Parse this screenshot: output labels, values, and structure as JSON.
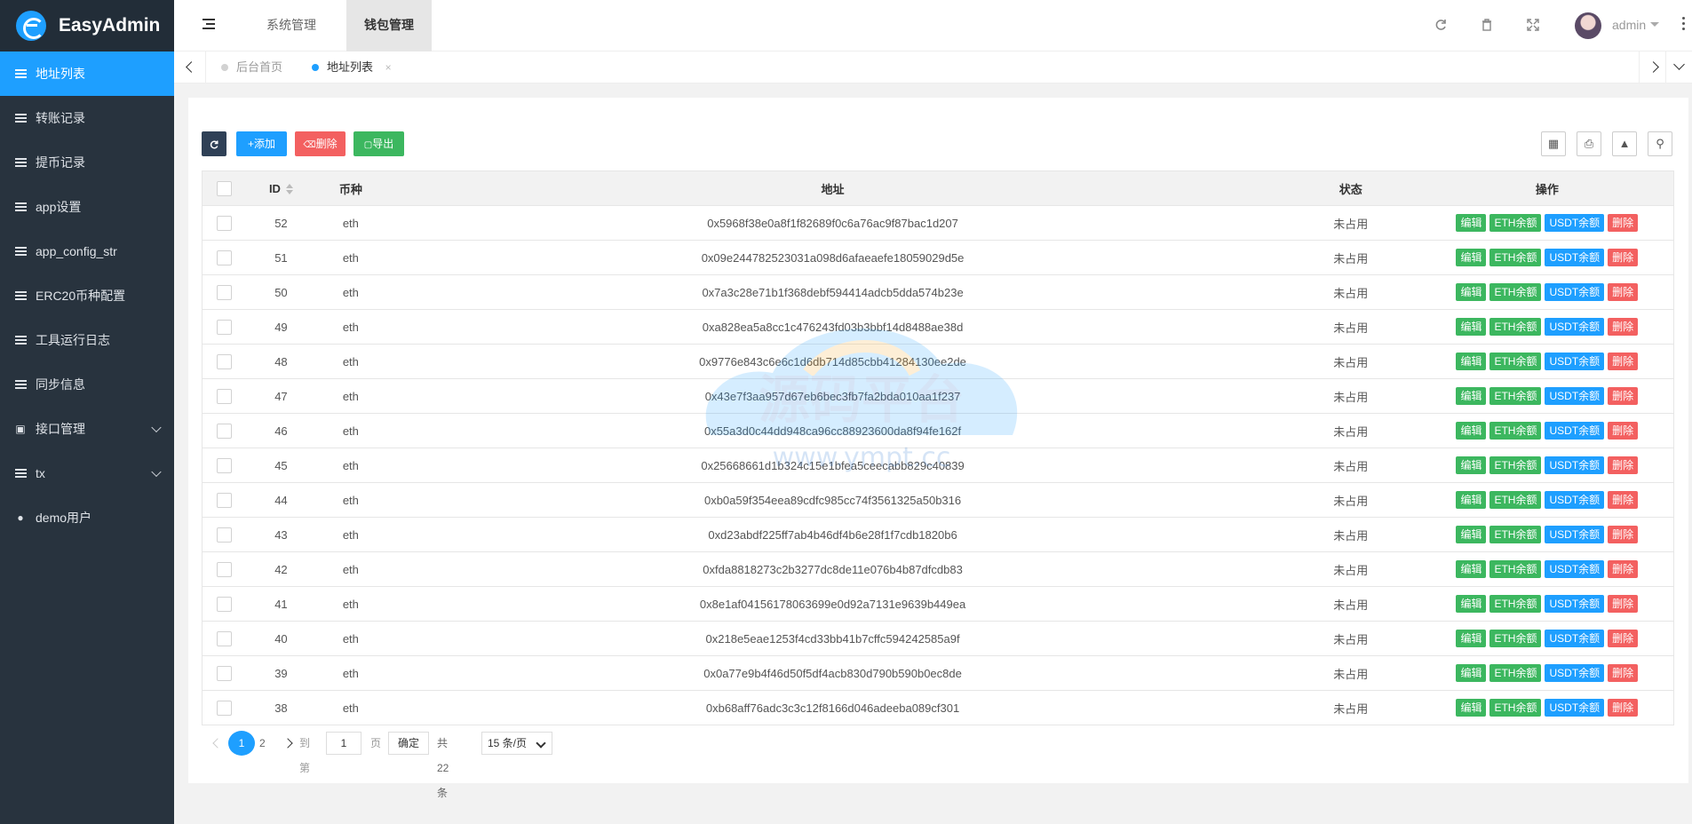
{
  "app": {
    "name": "EasyAdmin"
  },
  "sidebar": {
    "items": [
      {
        "label": "地址列表",
        "icon": "list-icon",
        "active": true
      },
      {
        "label": "转账记录",
        "icon": "list-icon"
      },
      {
        "label": "提币记录",
        "icon": "list-icon"
      },
      {
        "label": "app设置",
        "icon": "list-icon"
      },
      {
        "label": "app_config_str",
        "icon": "list-icon"
      },
      {
        "label": "ERC20币种配置",
        "icon": "list-icon"
      },
      {
        "label": "工具运行日志",
        "icon": "list-icon"
      },
      {
        "label": "同步信息",
        "icon": "list-icon"
      },
      {
        "label": "接口管理",
        "icon": "contact-card-icon",
        "expandable": true
      },
      {
        "label": "tx",
        "icon": "list-icon",
        "expandable": true
      },
      {
        "label": "demo用户",
        "icon": "user-icon"
      }
    ]
  },
  "header": {
    "tabs": [
      {
        "label": "系统管理"
      },
      {
        "label": "钱包管理",
        "active": true
      }
    ],
    "user": "admin"
  },
  "tabbar": {
    "tabs": [
      {
        "label": "后台首页"
      },
      {
        "label": "地址列表",
        "active": true
      }
    ],
    "close_glyph": "×"
  },
  "toolbar": {
    "add": "添加",
    "delete": "删除",
    "export": "导出"
  },
  "table": {
    "columns": {
      "id": "ID",
      "coin": "币种",
      "address": "地址",
      "status": "状态",
      "actions": "操作"
    },
    "action_labels": {
      "edit": "编辑",
      "eth": "ETH余额",
      "usdt": "USDT余额",
      "del": "删除"
    },
    "rows": [
      {
        "id": "52",
        "coin": "eth",
        "address": "0x5968f38e0a8f1f82689f0c6a76ac9f87bac1d207",
        "status": "未占用"
      },
      {
        "id": "51",
        "coin": "eth",
        "address": "0x09e244782523031a098d6afaeaefe18059029d5e",
        "status": "未占用"
      },
      {
        "id": "50",
        "coin": "eth",
        "address": "0x7a3c28e71b1f368debf594414adcb5dda574b23e",
        "status": "未占用"
      },
      {
        "id": "49",
        "coin": "eth",
        "address": "0xa828ea5a8cc1c476243fd03b3bbf14d8488ae38d",
        "status": "未占用"
      },
      {
        "id": "48",
        "coin": "eth",
        "address": "0x9776e843c6e6c1d6db714d85cbb41284130ee2de",
        "status": "未占用"
      },
      {
        "id": "47",
        "coin": "eth",
        "address": "0x43e7f3aa957d67eb6bec3fb7fa2bda010aa1f237",
        "status": "未占用"
      },
      {
        "id": "46",
        "coin": "eth",
        "address": "0x55a3d0c44dd948ca96cc88923600da8f94fe162f",
        "status": "未占用"
      },
      {
        "id": "45",
        "coin": "eth",
        "address": "0x25668661d1b324c15e1bfea5ceecabb829c40839",
        "status": "未占用"
      },
      {
        "id": "44",
        "coin": "eth",
        "address": "0xb0a59f354eea89cdfc985cc74f3561325a50b316",
        "status": "未占用"
      },
      {
        "id": "43",
        "coin": "eth",
        "address": "0xd23abdf225ff7ab4b46df4b6e28f1f7cdb1820b6",
        "status": "未占用"
      },
      {
        "id": "42",
        "coin": "eth",
        "address": "0xfda8818273c2b3277dc8de11e076b4b87dfcdb83",
        "status": "未占用"
      },
      {
        "id": "41",
        "coin": "eth",
        "address": "0x8e1af04156178063699e0d92a7131e9639b449ea",
        "status": "未占用"
      },
      {
        "id": "40",
        "coin": "eth",
        "address": "0x218e5eae1253f4cd33bb41b7cffc594242585a9f",
        "status": "未占用"
      },
      {
        "id": "39",
        "coin": "eth",
        "address": "0x0a77e9b4f46d50f5df4acb830d790b590b0ec8de",
        "status": "未占用"
      },
      {
        "id": "38",
        "coin": "eth",
        "address": "0xb68aff76adc3c3c12f8166d046adeeba089cf301",
        "status": "未占用"
      }
    ]
  },
  "pagination": {
    "current": "1",
    "page2": "2",
    "goto_label": "到第",
    "goto_value": "1",
    "page_label": "页",
    "confirm": "确定",
    "total": "共 22 条",
    "page_size": "15 条/页"
  },
  "watermark": {
    "text": "源码平台",
    "url": "www.ympt.cc"
  },
  "colors": {
    "primary": "#1e9fff",
    "sidebar": "#28333e",
    "green": "#3cb75f",
    "red": "#f36060"
  }
}
